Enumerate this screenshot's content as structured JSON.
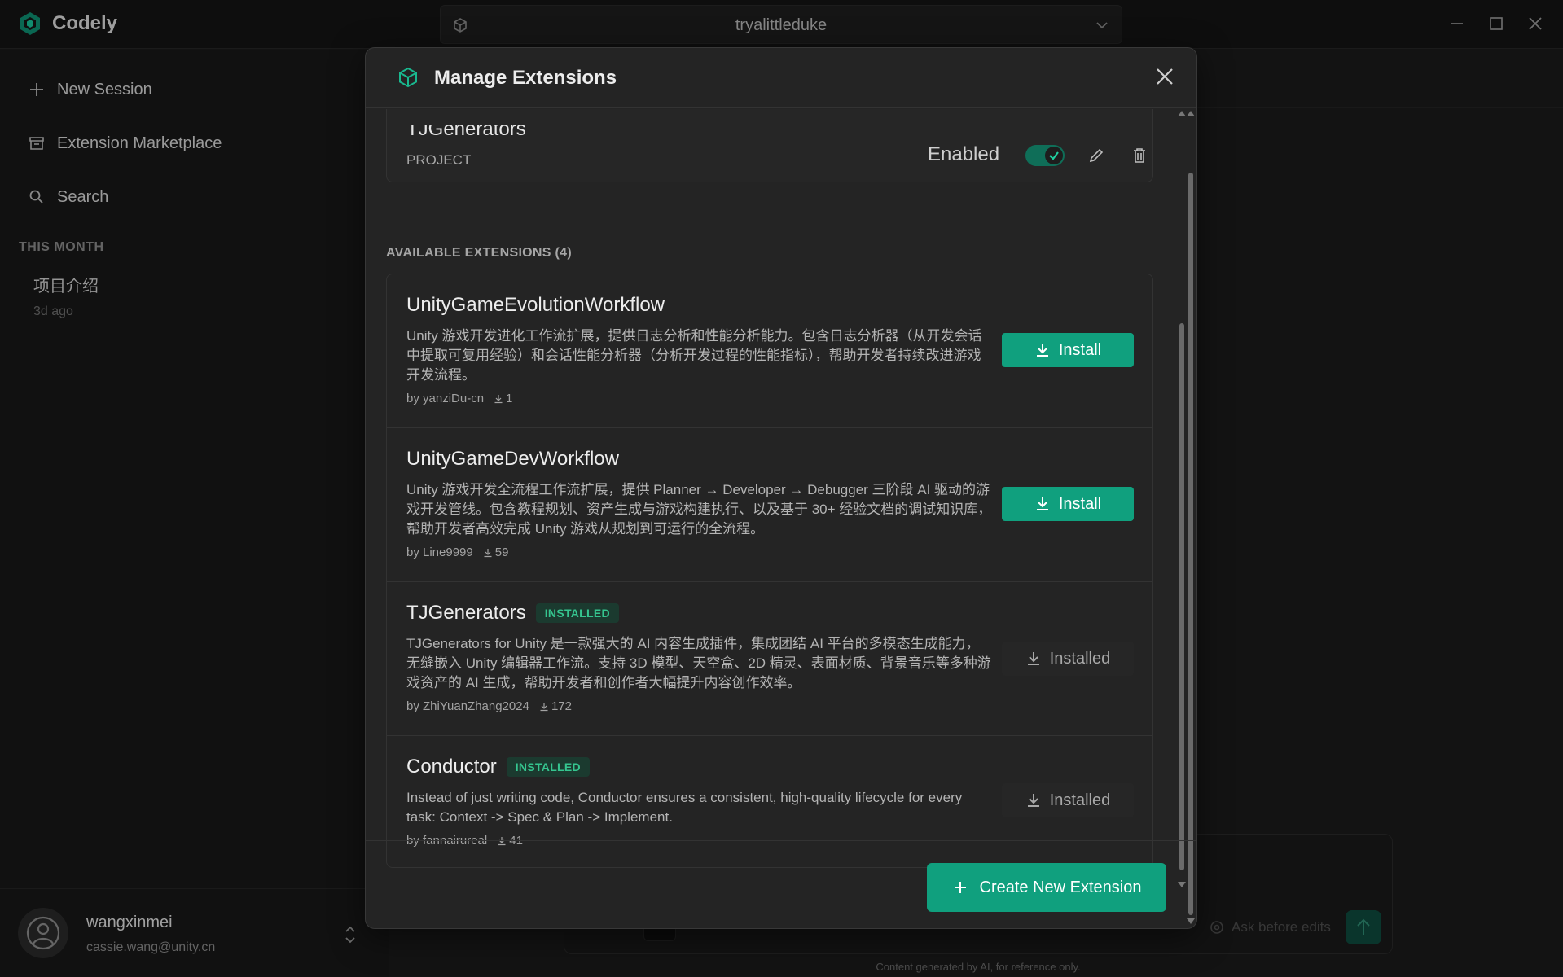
{
  "app": {
    "name": "Codely",
    "workspace": "tryalittleduke"
  },
  "sidebar": {
    "new_session": "New Session",
    "marketplace": "Extension Marketplace",
    "search": "Search",
    "section_label": "THIS MONTH",
    "sessions": [
      {
        "title": "项目介绍",
        "time": "3d ago"
      }
    ],
    "user": {
      "name": "wangxinmei",
      "email": "cassie.wang@unity.cn"
    }
  },
  "composer": {
    "mode_label": "Ask before edits",
    "disclaimer": "Content generated by AI, for reference only."
  },
  "modal": {
    "title": "Manage Extensions",
    "installed_top": {
      "name": "TJGenerators",
      "scope": "PROJECT",
      "status": "Enabled",
      "enabled": true
    },
    "available_header": "AVAILABLE EXTENSIONS (4)",
    "extensions": [
      {
        "name": "UnityGameEvolutionWorkflow",
        "badge": "",
        "description": "Unity 游戏开发进化工作流扩展，提供日志分析和性能分析能力。包含日志分析器（从开发会话中提取可复用经验）和会话性能分析器（分析开发过程的性能指标），帮助开发者持续改进游戏开发流程。",
        "author": "by yanziDu-cn",
        "downloads": "1",
        "action": "Install"
      },
      {
        "name": "UnityGameDevWorkflow",
        "badge": "",
        "description": "Unity 游戏开发全流程工作流扩展，提供 Planner → Developer → Debugger 三阶段 AI 驱动的游戏开发管线。包含教程规划、资产生成与游戏构建执行、以及基于 30+ 经验文档的调试知识库，帮助开发者高效完成 Unity 游戏从规划到可运行的全流程。",
        "author": "by Line9999",
        "downloads": "59",
        "action": "Install"
      },
      {
        "name": "TJGenerators",
        "badge": "INSTALLED",
        "description": "TJGenerators for Unity 是一款强大的 AI 内容生成插件，集成团结 AI 平台的多模态生成能力，无缝嵌入 Unity 编辑器工作流。支持 3D 模型、天空盒、2D 精灵、表面材质、背景音乐等多种游戏资产的 AI 生成，帮助开发者和创作者大幅提升内容创作效率。",
        "author": "by ZhiYuanZhang2024",
        "downloads": "172",
        "action": "Installed"
      },
      {
        "name": "Conductor",
        "badge": "INSTALLED",
        "description": "Instead of just writing code, Conductor ensures a consistent, high-quality lifecycle for every task: Context -> Spec & Plan -> Implement.",
        "author": "by fannairureal",
        "downloads": "41",
        "action": "Installed"
      }
    ],
    "create_button": "Create New Extension"
  },
  "colors": {
    "accent": "#10a07e",
    "badge_text": "#35c58f",
    "background": "#1b1b1b",
    "modal": "#242424"
  },
  "icons": {
    "logo": "hexagon-logo-icon",
    "workspace": "cube-icon",
    "download": "download-icon",
    "edit": "pencil-icon",
    "delete": "trash-icon"
  }
}
